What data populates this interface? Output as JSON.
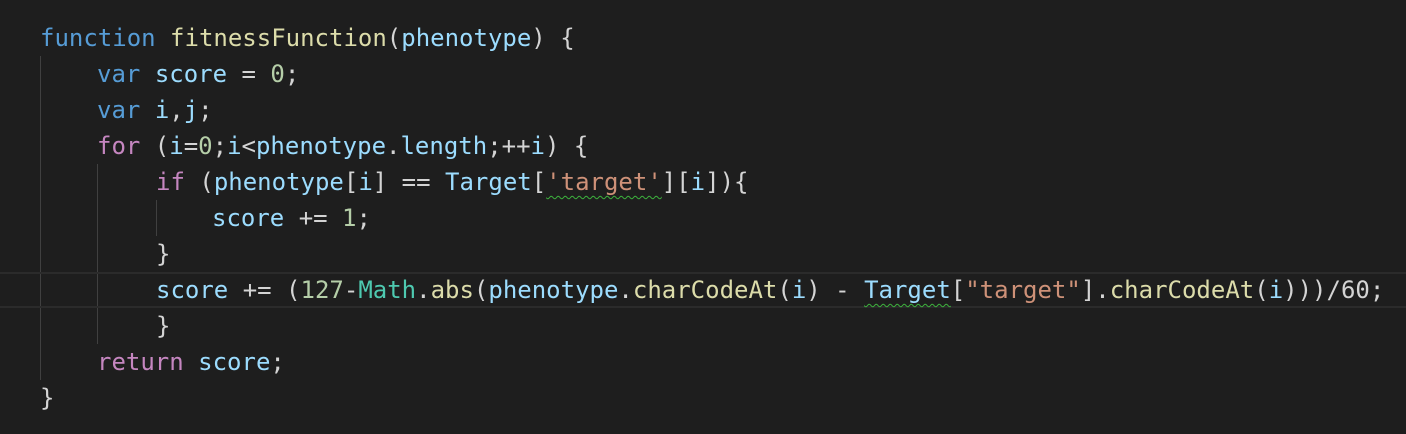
{
  "editor": {
    "background": "#1e1e1e",
    "theme_colors": {
      "keyword": "#569cd6",
      "control": "#c586c0",
      "function": "#dcdcaa",
      "variable": "#9cdcfe",
      "number": "#b5cea8",
      "string": "#ce9178",
      "class": "#4ec9b0",
      "squiggle": "#3db33d"
    },
    "lines": [
      {
        "tokens": [
          {
            "t": "function",
            "c": "kw-blue"
          },
          {
            "t": " ",
            "c": "punc"
          },
          {
            "t": "fitnessFunction",
            "c": "fn"
          },
          {
            "t": "(",
            "c": "punc"
          },
          {
            "t": "phenotype",
            "c": "var"
          },
          {
            "t": ") {",
            "c": "punc"
          }
        ]
      },
      {
        "tokens": [
          {
            "t": "var",
            "c": "kw-blue"
          },
          {
            "t": " ",
            "c": "punc"
          },
          {
            "t": "score",
            "c": "var"
          },
          {
            "t": " = ",
            "c": "punc"
          },
          {
            "t": "0",
            "c": "num"
          },
          {
            "t": ";",
            "c": "punc"
          }
        ]
      },
      {
        "tokens": [
          {
            "t": "var",
            "c": "kw-blue"
          },
          {
            "t": " ",
            "c": "punc"
          },
          {
            "t": "i",
            "c": "var"
          },
          {
            "t": ",",
            "c": "punc"
          },
          {
            "t": "j",
            "c": "var"
          },
          {
            "t": ";",
            "c": "punc"
          }
        ]
      },
      {
        "tokens": [
          {
            "t": "for",
            "c": "kw-purple"
          },
          {
            "t": " (",
            "c": "punc"
          },
          {
            "t": "i",
            "c": "var"
          },
          {
            "t": "=",
            "c": "punc"
          },
          {
            "t": "0",
            "c": "num"
          },
          {
            "t": ";",
            "c": "punc"
          },
          {
            "t": "i",
            "c": "var"
          },
          {
            "t": "<",
            "c": "punc"
          },
          {
            "t": "phenotype",
            "c": "var"
          },
          {
            "t": ".",
            "c": "punc"
          },
          {
            "t": "length",
            "c": "var"
          },
          {
            "t": ";++",
            "c": "punc"
          },
          {
            "t": "i",
            "c": "var"
          },
          {
            "t": ") {",
            "c": "punc"
          }
        ]
      },
      {
        "tokens": [
          {
            "t": "if",
            "c": "kw-purple"
          },
          {
            "t": " (",
            "c": "punc"
          },
          {
            "t": "phenotype",
            "c": "var"
          },
          {
            "t": "[",
            "c": "punc"
          },
          {
            "t": "i",
            "c": "var"
          },
          {
            "t": "] == ",
            "c": "punc"
          },
          {
            "t": "Target",
            "c": "var"
          },
          {
            "t": "[",
            "c": "punc"
          },
          {
            "t": "'target'",
            "c": "str",
            "squiggle": true
          },
          {
            "t": "][",
            "c": "punc"
          },
          {
            "t": "i",
            "c": "var"
          },
          {
            "t": "]){",
            "c": "punc"
          }
        ]
      },
      {
        "tokens": [
          {
            "t": "score",
            "c": "var"
          },
          {
            "t": " += ",
            "c": "punc"
          },
          {
            "t": "1",
            "c": "num"
          },
          {
            "t": ";",
            "c": "punc"
          }
        ]
      },
      {
        "tokens": [
          {
            "t": "}",
            "c": "punc"
          }
        ]
      },
      {
        "tokens": [
          {
            "t": "score",
            "c": "var"
          },
          {
            "t": " += (",
            "c": "punc"
          },
          {
            "t": "127",
            "c": "num"
          },
          {
            "t": "-",
            "c": "punc"
          },
          {
            "t": "Math",
            "c": "cls"
          },
          {
            "t": ".",
            "c": "punc"
          },
          {
            "t": "abs",
            "c": "fn"
          },
          {
            "t": "(",
            "c": "punc"
          },
          {
            "t": "phenotype",
            "c": "var"
          },
          {
            "t": ".",
            "c": "punc"
          },
          {
            "t": "charCodeAt",
            "c": "fn"
          },
          {
            "t": "(",
            "c": "punc"
          },
          {
            "t": "i",
            "c": "var"
          },
          {
            "t": ") - ",
            "c": "punc"
          },
          {
            "t": "Target",
            "c": "var",
            "squiggle": true
          },
          {
            "t": "[",
            "c": "punc"
          },
          {
            "t": "\"target\"",
            "c": "str"
          },
          {
            "t": "].",
            "c": "punc"
          },
          {
            "t": "charCodeAt",
            "c": "fn"
          },
          {
            "t": "(",
            "c": "punc"
          },
          {
            "t": "i",
            "c": "var"
          },
          {
            "t": ")))/60;",
            "c": "punc"
          }
        ]
      },
      {
        "tokens": [
          {
            "t": "}",
            "c": "punc"
          }
        ]
      },
      {
        "tokens": [
          {
            "t": "return",
            "c": "kw-purple"
          },
          {
            "t": " ",
            "c": "punc"
          },
          {
            "t": "score",
            "c": "var"
          },
          {
            "t": ";",
            "c": "punc"
          }
        ]
      },
      {
        "tokens": [
          {
            "t": "}",
            "c": "punc"
          }
        ]
      }
    ]
  }
}
